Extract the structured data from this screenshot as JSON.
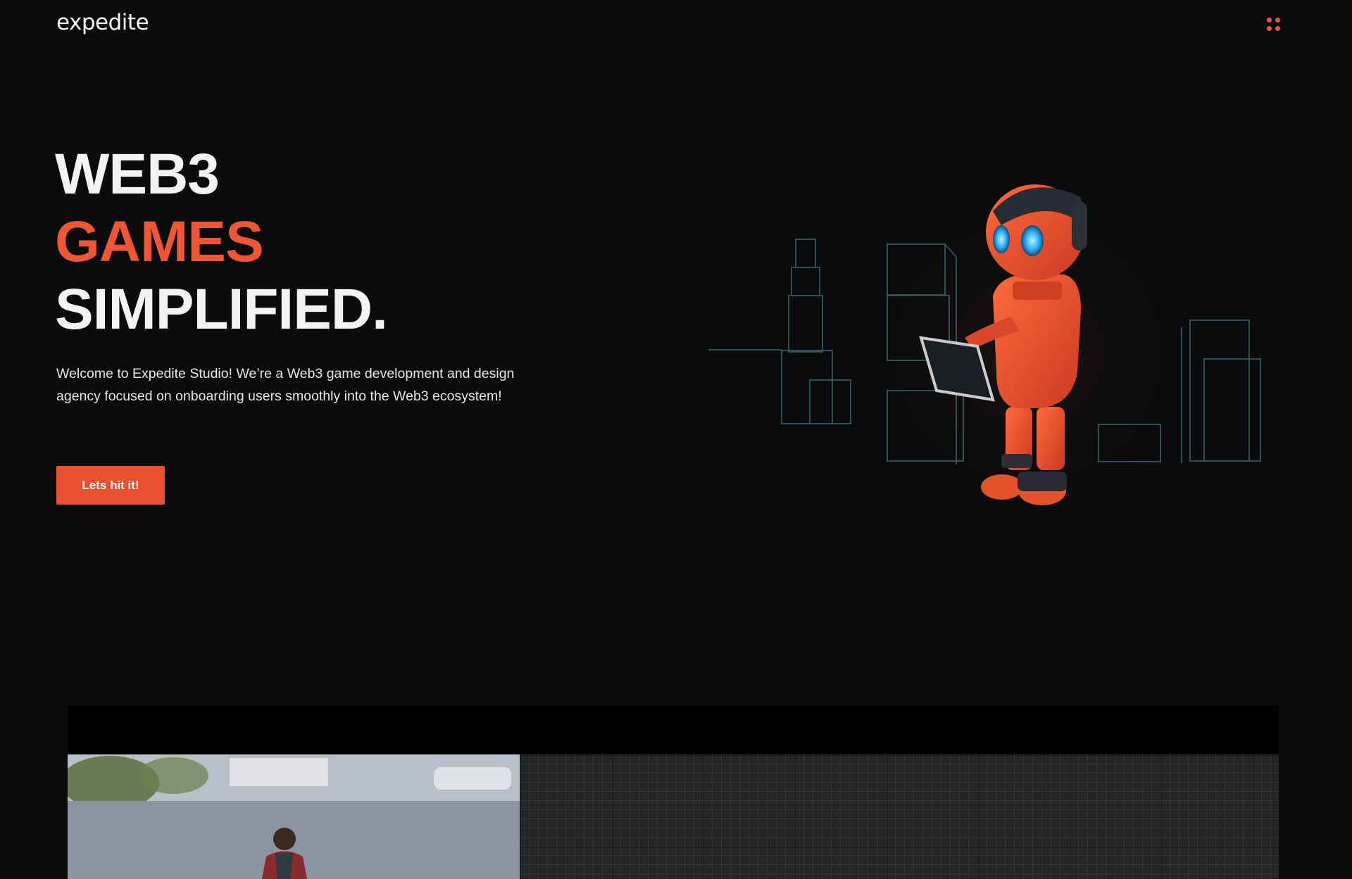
{
  "header": {
    "logo_text": "expedite",
    "menu_icon": "grid-dots-icon",
    "accent_color": "#ef5634"
  },
  "hero": {
    "headline_line1": "WEB3",
    "headline_line2": "GAMES",
    "headline_line3": "SIMPLIFIED.",
    "intro_line1": "Welcome to Expedite Studio! We’re a Web3 game development and design",
    "intro_line2": "agency focused on onboarding users smoothly into the Web3 ecosystem!",
    "cta_label": "Lets hit it!",
    "illustration": "robot-with-tablet-illustration"
  },
  "showcase": {
    "left_thumbnail": "character-on-street-photo",
    "right_thumbnail": "grid-canvas-preview"
  },
  "colors": {
    "background": "#0a0b0c",
    "accent": "#ef5634",
    "robot_eye": "#2fb6ff",
    "neon_outline": "#3a5b66"
  }
}
